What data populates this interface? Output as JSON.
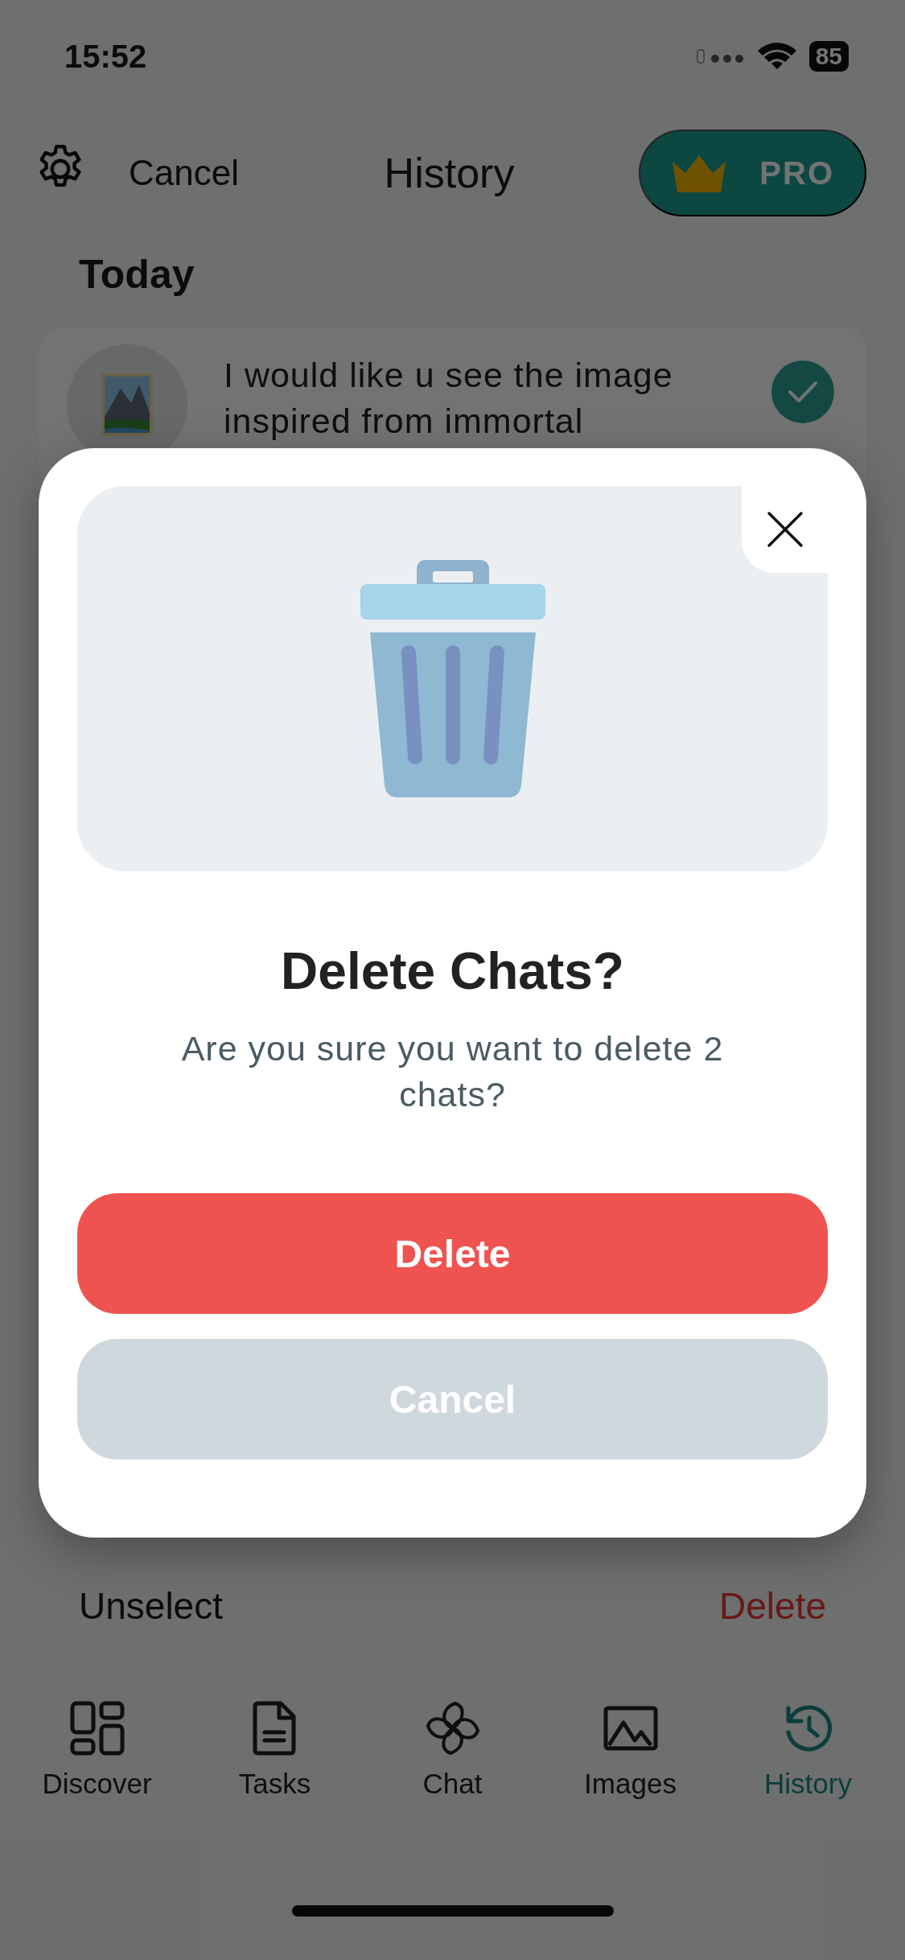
{
  "status_bar": {
    "time": "15:52",
    "battery": "85"
  },
  "header": {
    "cancel": "Cancel",
    "title": "History",
    "pro_badge": "PRO"
  },
  "section_title": "Today",
  "chats": [
    {
      "text": "I would like u see the image inspired from immortal",
      "selected": true
    }
  ],
  "bottom_actions": {
    "unselect": "Unselect",
    "delete": "Delete"
  },
  "tab_bar": [
    {
      "label": "Discover",
      "kind": "grid",
      "selected": false
    },
    {
      "label": "Tasks",
      "kind": "document",
      "selected": false
    },
    {
      "label": "Chat",
      "kind": "swirl",
      "selected": false
    },
    {
      "label": "Images",
      "kind": "picture",
      "selected": false
    },
    {
      "label": "History",
      "kind": "history",
      "selected": true
    }
  ],
  "dialog": {
    "title": "Delete Chats?",
    "message": "Are you sure you want to delete 2 chats?",
    "buttons": [
      {
        "label": "Delete",
        "kind": "destructive"
      },
      {
        "label": "Cancel",
        "kind": "secondary"
      }
    ]
  }
}
